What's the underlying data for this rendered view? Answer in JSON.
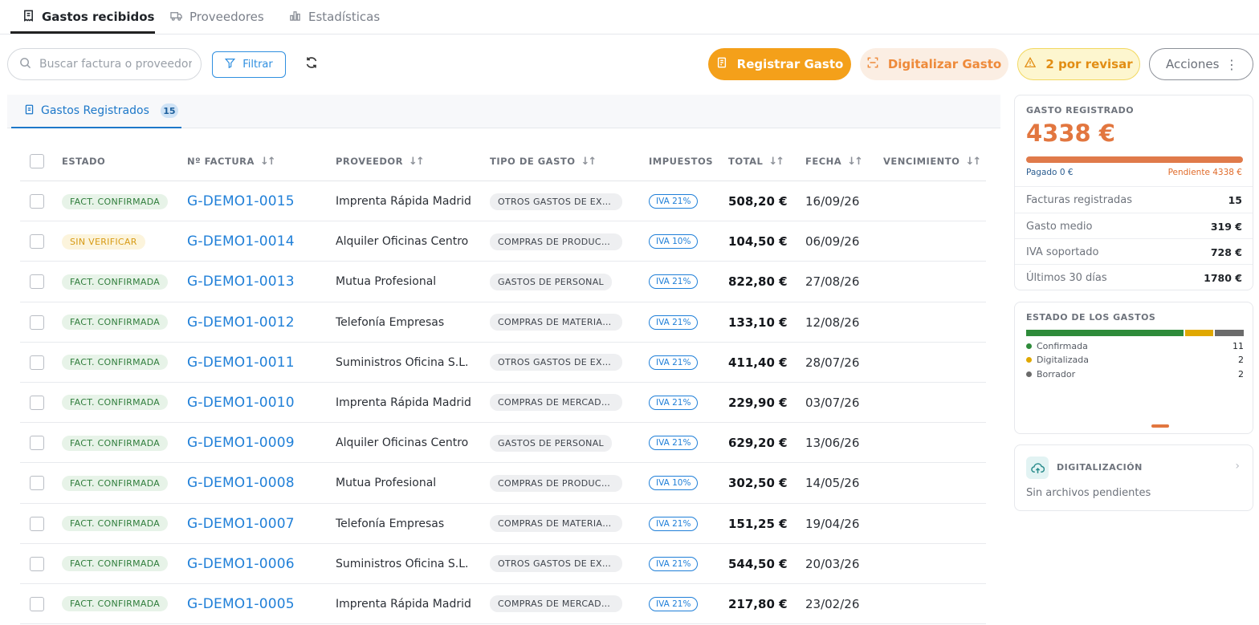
{
  "nav": {
    "tabs": [
      {
        "label": "Gastos recibidos",
        "active": true
      },
      {
        "label": "Proveedores",
        "active": false
      },
      {
        "label": "Estadísticas",
        "active": false
      }
    ]
  },
  "toolbar": {
    "search_placeholder": "Buscar factura o proveedor",
    "filter_label": "Filtrar",
    "register_label": "Registrar Gasto",
    "digitize_label": "Digitalizar Gasto",
    "review_label": "2 por revisar",
    "actions_label": "Acciones"
  },
  "section": {
    "tab_label": "Gastos Registrados",
    "count": "15"
  },
  "table": {
    "headers": {
      "estado": "ESTADO",
      "factura": "Nº FACTURA",
      "proveedor": "PROVEEDOR",
      "tipo": "TIPO DE GASTO",
      "impuestos": "IMPUESTOS",
      "total": "TOTAL",
      "fecha": "FECHA",
      "vencimiento": "VENCIMIENTO"
    },
    "rows": [
      {
        "estado": "FACT. CONFIRMADA",
        "status_kind": "ok",
        "factura": "G-DEMO1-0015",
        "proveedor": "Imprenta Rápida Madrid",
        "tipo": "OTROS GASTOS DE EXPLOTACIÓN",
        "impuestos": "IVA 21%",
        "total": "508,20 €",
        "fecha": "16/09/26"
      },
      {
        "estado": "SIN VERIFICAR",
        "status_kind": "pend",
        "factura": "G-DEMO1-0014",
        "proveedor": "Alquiler Oficinas Centro",
        "tipo": "COMPRAS DE PRODUCTOS",
        "impuestos": "IVA 10%",
        "total": "104,50 €",
        "fecha": "06/09/26"
      },
      {
        "estado": "FACT. CONFIRMADA",
        "status_kind": "ok",
        "factura": "G-DEMO1-0013",
        "proveedor": "Mutua Profesional",
        "tipo": "GASTOS DE PERSONAL",
        "impuestos": "IVA 21%",
        "total": "822,80 €",
        "fecha": "27/08/26"
      },
      {
        "estado": "FACT. CONFIRMADA",
        "status_kind": "ok",
        "factura": "G-DEMO1-0012",
        "proveedor": "Telefonía Empresas",
        "tipo": "COMPRAS DE MATERIALES",
        "impuestos": "IVA 21%",
        "total": "133,10 €",
        "fecha": "12/08/26"
      },
      {
        "estado": "FACT. CONFIRMADA",
        "status_kind": "ok",
        "factura": "G-DEMO1-0011",
        "proveedor": "Suministros Oficina S.L.",
        "tipo": "OTROS GASTOS DE EXPLOTACIÓN",
        "impuestos": "IVA 21%",
        "total": "411,40 €",
        "fecha": "28/07/26"
      },
      {
        "estado": "FACT. CONFIRMADA",
        "status_kind": "ok",
        "factura": "G-DEMO1-0010",
        "proveedor": "Imprenta Rápida Madrid",
        "tipo": "COMPRAS DE MERCADERÍAS",
        "impuestos": "IVA 21%",
        "total": "229,90 €",
        "fecha": "03/07/26"
      },
      {
        "estado": "FACT. CONFIRMADA",
        "status_kind": "ok",
        "factura": "G-DEMO1-0009",
        "proveedor": "Alquiler Oficinas Centro",
        "tipo": "GASTOS DE PERSONAL",
        "impuestos": "IVA 21%",
        "total": "629,20 €",
        "fecha": "13/06/26"
      },
      {
        "estado": "FACT. CONFIRMADA",
        "status_kind": "ok",
        "factura": "G-DEMO1-0008",
        "proveedor": "Mutua Profesional",
        "tipo": "COMPRAS DE PRODUCTOS",
        "impuestos": "IVA 10%",
        "total": "302,50 €",
        "fecha": "14/05/26"
      },
      {
        "estado": "FACT. CONFIRMADA",
        "status_kind": "ok",
        "factura": "G-DEMO1-0007",
        "proveedor": "Telefonía Empresas",
        "tipo": "COMPRAS DE MATERIALES",
        "impuestos": "IVA 21%",
        "total": "151,25 €",
        "fecha": "19/04/26"
      },
      {
        "estado": "FACT. CONFIRMADA",
        "status_kind": "ok",
        "factura": "G-DEMO1-0006",
        "proveedor": "Suministros Oficina S.L.",
        "tipo": "OTROS GASTOS DE EXPLOTACIÓN",
        "impuestos": "IVA 21%",
        "total": "544,50 €",
        "fecha": "20/03/26"
      },
      {
        "estado": "FACT. CONFIRMADA",
        "status_kind": "ok",
        "factura": "G-DEMO1-0005",
        "proveedor": "Imprenta Rápida Madrid",
        "tipo": "COMPRAS DE MERCADERÍAS",
        "impuestos": "IVA 21%",
        "total": "217,80 €",
        "fecha": "23/02/26"
      }
    ]
  },
  "summary": {
    "title": "GASTO REGISTRADO",
    "amount": "4338 €",
    "paid": "Pagado 0 €",
    "pending": "Pendiente 4338 €",
    "stats": [
      {
        "label": "Facturas registradas",
        "value": "15"
      },
      {
        "label": "Gasto medio",
        "value": "319 €"
      },
      {
        "label": "IVA soportado",
        "value": "728 €"
      },
      {
        "label": "Últimos 30 días",
        "value": "1780 €"
      }
    ]
  },
  "status_panel": {
    "title": "ESTADO DE LOS GASTOS",
    "items": [
      {
        "label": "Confirmada",
        "count": "11",
        "value": 11,
        "color": "#2e8b3a"
      },
      {
        "label": "Digitalizada",
        "count": "2",
        "value": 2,
        "color": "#e0a800"
      },
      {
        "label": "Borrador",
        "count": "2",
        "value": 2,
        "color": "#6b6b6b"
      }
    ]
  },
  "digitalizacion": {
    "title": "DIGITALIZACIÓN",
    "subtitle": "Sin archivos pendientes"
  },
  "colors": {
    "accent": "#f4a01a",
    "link": "#1f7fd8",
    "amount": "#e2763f"
  }
}
